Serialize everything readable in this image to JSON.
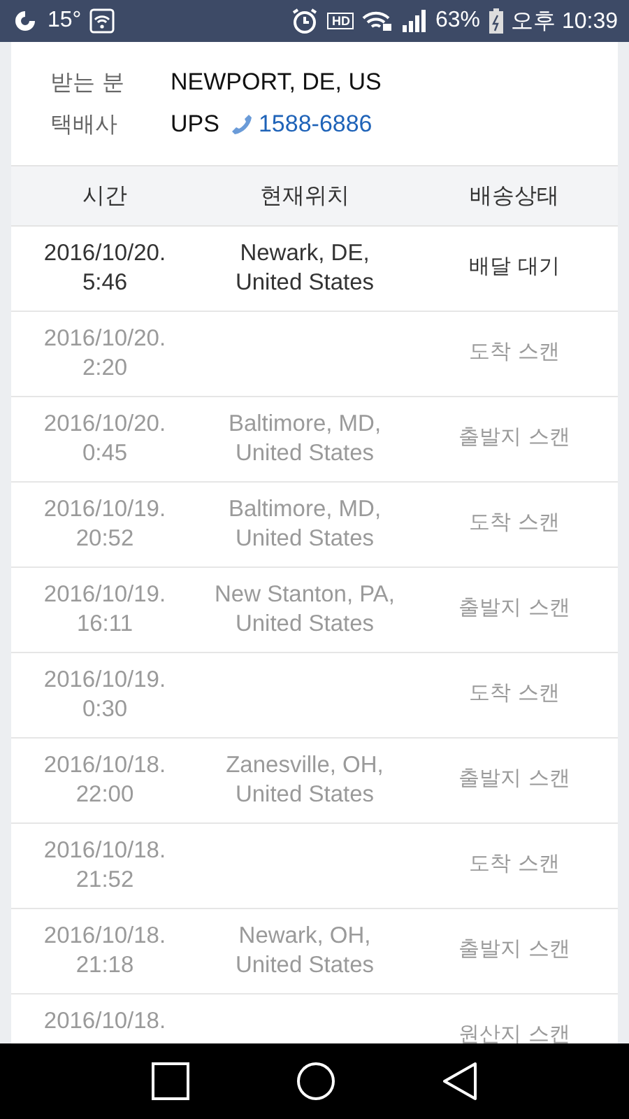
{
  "status_bar": {
    "temperature": "15°",
    "hd_badge": "HD",
    "battery": "63%",
    "time": "오후 10:39"
  },
  "info": [
    {
      "label": "받는 분",
      "value": "NEWPORT, DE, US"
    },
    {
      "label": "택배사",
      "value": "UPS",
      "phone": "1588-6886"
    }
  ],
  "table": {
    "columns": [
      "시간",
      "현재위치",
      "배송상태"
    ],
    "rows": [
      {
        "time": [
          "2016/10/20.",
          "5:46"
        ],
        "location": [
          "Newark, DE,",
          "United States"
        ],
        "status": "배달 대기",
        "latest": true
      },
      {
        "time": [
          "2016/10/20.",
          "2:20"
        ],
        "location": [],
        "status": "도착 스캔",
        "latest": false
      },
      {
        "time": [
          "2016/10/20.",
          "0:45"
        ],
        "location": [
          "Baltimore, MD,",
          "United States"
        ],
        "status": "출발지 스캔",
        "latest": false
      },
      {
        "time": [
          "2016/10/19.",
          "20:52"
        ],
        "location": [
          "Baltimore, MD,",
          "United States"
        ],
        "status": "도착 스캔",
        "latest": false
      },
      {
        "time": [
          "2016/10/19.",
          "16:11"
        ],
        "location": [
          "New Stanton, PA,",
          "United States"
        ],
        "status": "출발지 스캔",
        "latest": false
      },
      {
        "time": [
          "2016/10/19.",
          "0:30"
        ],
        "location": [],
        "status": "도착 스캔",
        "latest": false
      },
      {
        "time": [
          "2016/10/18.",
          "22:00"
        ],
        "location": [
          "Zanesville, OH,",
          "United States"
        ],
        "status": "출발지 스캔",
        "latest": false
      },
      {
        "time": [
          "2016/10/18.",
          "21:52"
        ],
        "location": [],
        "status": "도착 스캔",
        "latest": false
      },
      {
        "time": [
          "2016/10/18.",
          "21:18"
        ],
        "location": [
          "Newark, OH,",
          "United States"
        ],
        "status": "출발지 스캔",
        "latest": false
      },
      {
        "time": [
          "2016/10/18."
        ],
        "location": [],
        "status": "원산지 스캔",
        "latest": false
      }
    ]
  }
}
